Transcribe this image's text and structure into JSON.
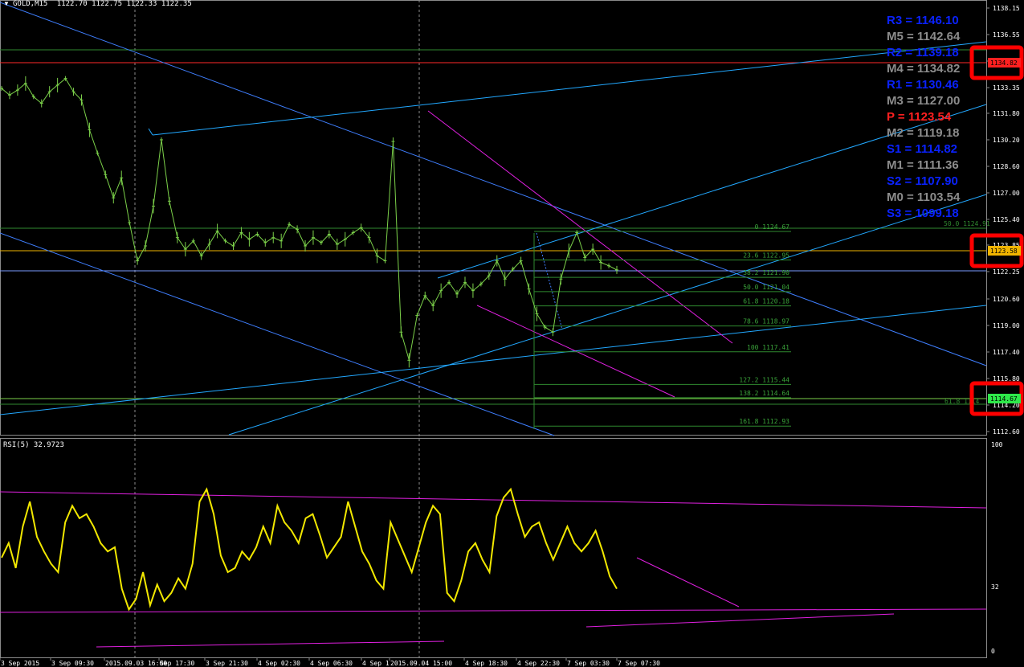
{
  "header": {
    "symbol": "GOLD,M15",
    "ohlc": "1122.70 1122.75 1122.33 1122.35"
  },
  "colors": {
    "background": "#000000",
    "candles": "#7cd14a",
    "fib": "#2f8a2f",
    "trend_blue": "#3f7fff",
    "trend_cyan": "#22a8ff",
    "magenta": "#e020e0",
    "rsi": "#f2e800",
    "pivot_blue": "#0a22ff",
    "pivot_gray": "#8c8c8c",
    "pivot_red": "#ff2020",
    "highlight_box": "#ff0000"
  },
  "pivots": [
    {
      "label": "R3 = 1146.10",
      "color": "blue"
    },
    {
      "label": "M5 = 1142.64",
      "color": "gray"
    },
    {
      "label": "R2 = 1139.18",
      "color": "blue"
    },
    {
      "label": "M4 = 1134.82",
      "color": "gray"
    },
    {
      "label": "R1 = 1130.46",
      "color": "blue"
    },
    {
      "label": "M3 = 1127.00",
      "color": "gray"
    },
    {
      "label": "P   = 1123.54",
      "color": "red"
    },
    {
      "label": "M2 = 1119.18",
      "color": "gray"
    },
    {
      "label": "S1 = 1114.82",
      "color": "blue"
    },
    {
      "label": "M1 = 1111.36",
      "color": "gray"
    },
    {
      "label": "S2 = 1107.90",
      "color": "blue"
    },
    {
      "label": "M0 = 1103.54",
      "color": "gray"
    },
    {
      "label": "S3 = 1099.18",
      "color": "blue"
    }
  ],
  "price_levels": [
    {
      "price": 1124.67,
      "label": "0 1124.67"
    },
    {
      "price": 1122.95,
      "label": "23.6 1122.95"
    },
    {
      "price": 1121.9,
      "label": "38.2 1121.90"
    },
    {
      "price": 1121.04,
      "label": "50.0 1121.04"
    },
    {
      "price": 1120.18,
      "label": "61.8 1120.18"
    },
    {
      "price": 1118.97,
      "label": "78.6 1118.97"
    },
    {
      "price": 1117.41,
      "label": "100 1117.41"
    },
    {
      "price": 1115.44,
      "label": "127.2 1115.44"
    },
    {
      "price": 1114.64,
      "label": "138.2 1114.64"
    },
    {
      "price": 1112.93,
      "label": "161.8 1112.93"
    }
  ],
  "extra_labels": {
    "upper_fib": "50.0 1124.91",
    "lower_fib": "61.8 1114"
  },
  "price_tags": [
    {
      "value": "1134.82",
      "bg": "#ff2020",
      "fg": "#000000"
    },
    {
      "value": "1123.58",
      "bg": "#f0b400",
      "fg": "#000000"
    },
    {
      "value": "1114.67",
      "bg": "#2ee84a",
      "fg": "#000000"
    }
  ],
  "rsi": {
    "title": "RSI(5) 32.9723",
    "value": 32.9723,
    "axis": [
      "100",
      "32",
      "0"
    ]
  },
  "chart_data": {
    "type": "line",
    "title": "GOLD,M15",
    "ylim": [
      1112.6,
      1138.15
    ],
    "y_ticks": [
      "1138.15",
      "1136.55",
      "1134.95",
      "1133.35",
      "1131.80",
      "1130.20",
      "1128.60",
      "1127.00",
      "1125.40",
      "1123.85",
      "1122.25",
      "1120.60",
      "1119.00",
      "1117.40",
      "1115.80",
      "1114.20",
      "1112.60"
    ],
    "x_ticks": [
      "3 Sep 2015",
      "3 Sep 09:30",
      "2015.09.03 16:00",
      "Sep 17:30",
      "3 Sep 21:30",
      "4 Sep 02:30",
      "4 Sep 06:30",
      "4 Sep 1",
      "2015.09.04 15:00",
      "4 Sep 18:30",
      "4 Sep 22:30",
      "7 Sep 03:30",
      "7 Sep 07:30"
    ],
    "series": [
      {
        "values": [
          1133.3,
          1132.9,
          1133.2,
          1133.6,
          1132.8,
          1132.4,
          1133.1,
          1133.5,
          1133.9,
          1133.1,
          1132.6,
          1130.8,
          1129.4,
          1128.1,
          1126.7,
          1127.9,
          1125.2,
          1122.9,
          1123.8,
          1126.2,
          1130.2,
          1126.5,
          1124.3,
          1123.6,
          1124.1,
          1123.2,
          1123.9,
          1124.7,
          1124.1,
          1123.8,
          1124.6,
          1124.2,
          1124.5,
          1124.0,
          1124.3,
          1124.1,
          1125.1,
          1124.8,
          1123.8,
          1124.3,
          1124.0,
          1124.5,
          1123.9,
          1124.2,
          1124.6,
          1124.9,
          1124.3,
          1123.2,
          1122.9,
          1130.1,
          1118.6,
          1116.9,
          1119.6,
          1120.8,
          1120.2,
          1121.1,
          1121.6,
          1120.9,
          1121.6,
          1121.1,
          1121.5,
          1122.0,
          1122.9,
          1121.8,
          1122.4,
          1122.9,
          1121.2,
          1119.7,
          1118.9,
          1118.6,
          1121.8,
          1123.5,
          1124.6,
          1123.1,
          1123.6,
          1122.8,
          1122.6,
          1122.35
        ]
      }
    ]
  },
  "rsi_data": {
    "type": "line",
    "ylim": [
      0,
      100
    ],
    "values": [
      45,
      52,
      40,
      60,
      72,
      55,
      48,
      42,
      38,
      62,
      70,
      64,
      66,
      60,
      52,
      48,
      50,
      30,
      20,
      25,
      38,
      22,
      32,
      24,
      28,
      35,
      30,
      42,
      72,
      78,
      66,
      46,
      38,
      40,
      48,
      44,
      50,
      60,
      52,
      70,
      62,
      58,
      52,
      64,
      66,
      56,
      45,
      50,
      55,
      72,
      60,
      48,
      42,
      34,
      30,
      62,
      54,
      46,
      38,
      50,
      62,
      70,
      66,
      28,
      24,
      34,
      48,
      52,
      44,
      38,
      65,
      74,
      78,
      66,
      55,
      60,
      62,
      52,
      44,
      52,
      60,
      52,
      48,
      52,
      58,
      48,
      36,
      30
    ]
  }
}
